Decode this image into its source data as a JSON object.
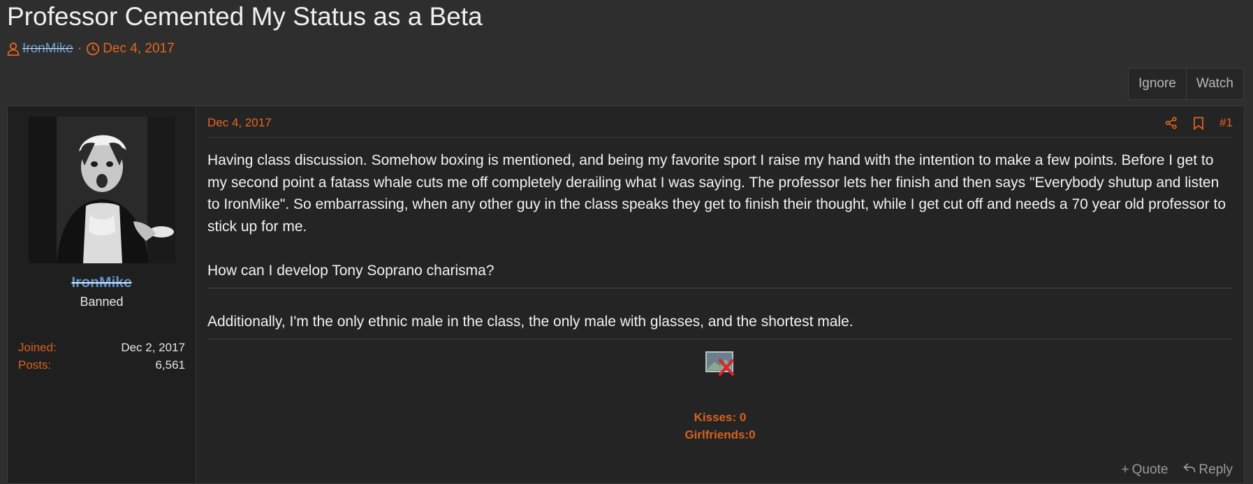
{
  "thread": {
    "title": "Professor Cemented My Status as a Beta",
    "author": "IronMike",
    "separator": "·",
    "date": "Dec 4, 2017"
  },
  "thread_actions": {
    "ignore_label": "Ignore",
    "watch_label": "Watch"
  },
  "user": {
    "name": "IronMike",
    "title": "Banned",
    "stats": [
      {
        "label": "Joined:",
        "value": "Dec 2, 2017"
      },
      {
        "label": "Posts:",
        "value": "6,561"
      }
    ]
  },
  "post": {
    "date": "Dec 4, 2017",
    "number": "#1",
    "paragraph1": "Having class discussion.  Somehow boxing is mentioned, and being my favorite sport I raise my hand with the intention to make a few points.  Before I get to my second point a fatass whale cuts me off completely derailing what I was saying.  The professor lets her finish and then says \"Everybody shutup and listen to IronMike\".  So embarrassing, when any other guy in the class speaks they get to finish their thought, while I get cut off and needs a 70 year old professor to stick up for me.",
    "paragraph2": "How can I develop Tony Soprano charisma?",
    "paragraph3": "Additionally, I'm the only ethnic male in the class, the only male with glasses, and the shortest male.",
    "sig_line1": "Kisses: 0",
    "sig_line2": "Girlfriends:0"
  },
  "post_actions": {
    "quote_label": "Quote",
    "reply_label": "Reply"
  },
  "colors": {
    "accent": "#e8661f",
    "username": "#5b93cf",
    "background": "#2e2e2e",
    "post_background": "#242424"
  }
}
